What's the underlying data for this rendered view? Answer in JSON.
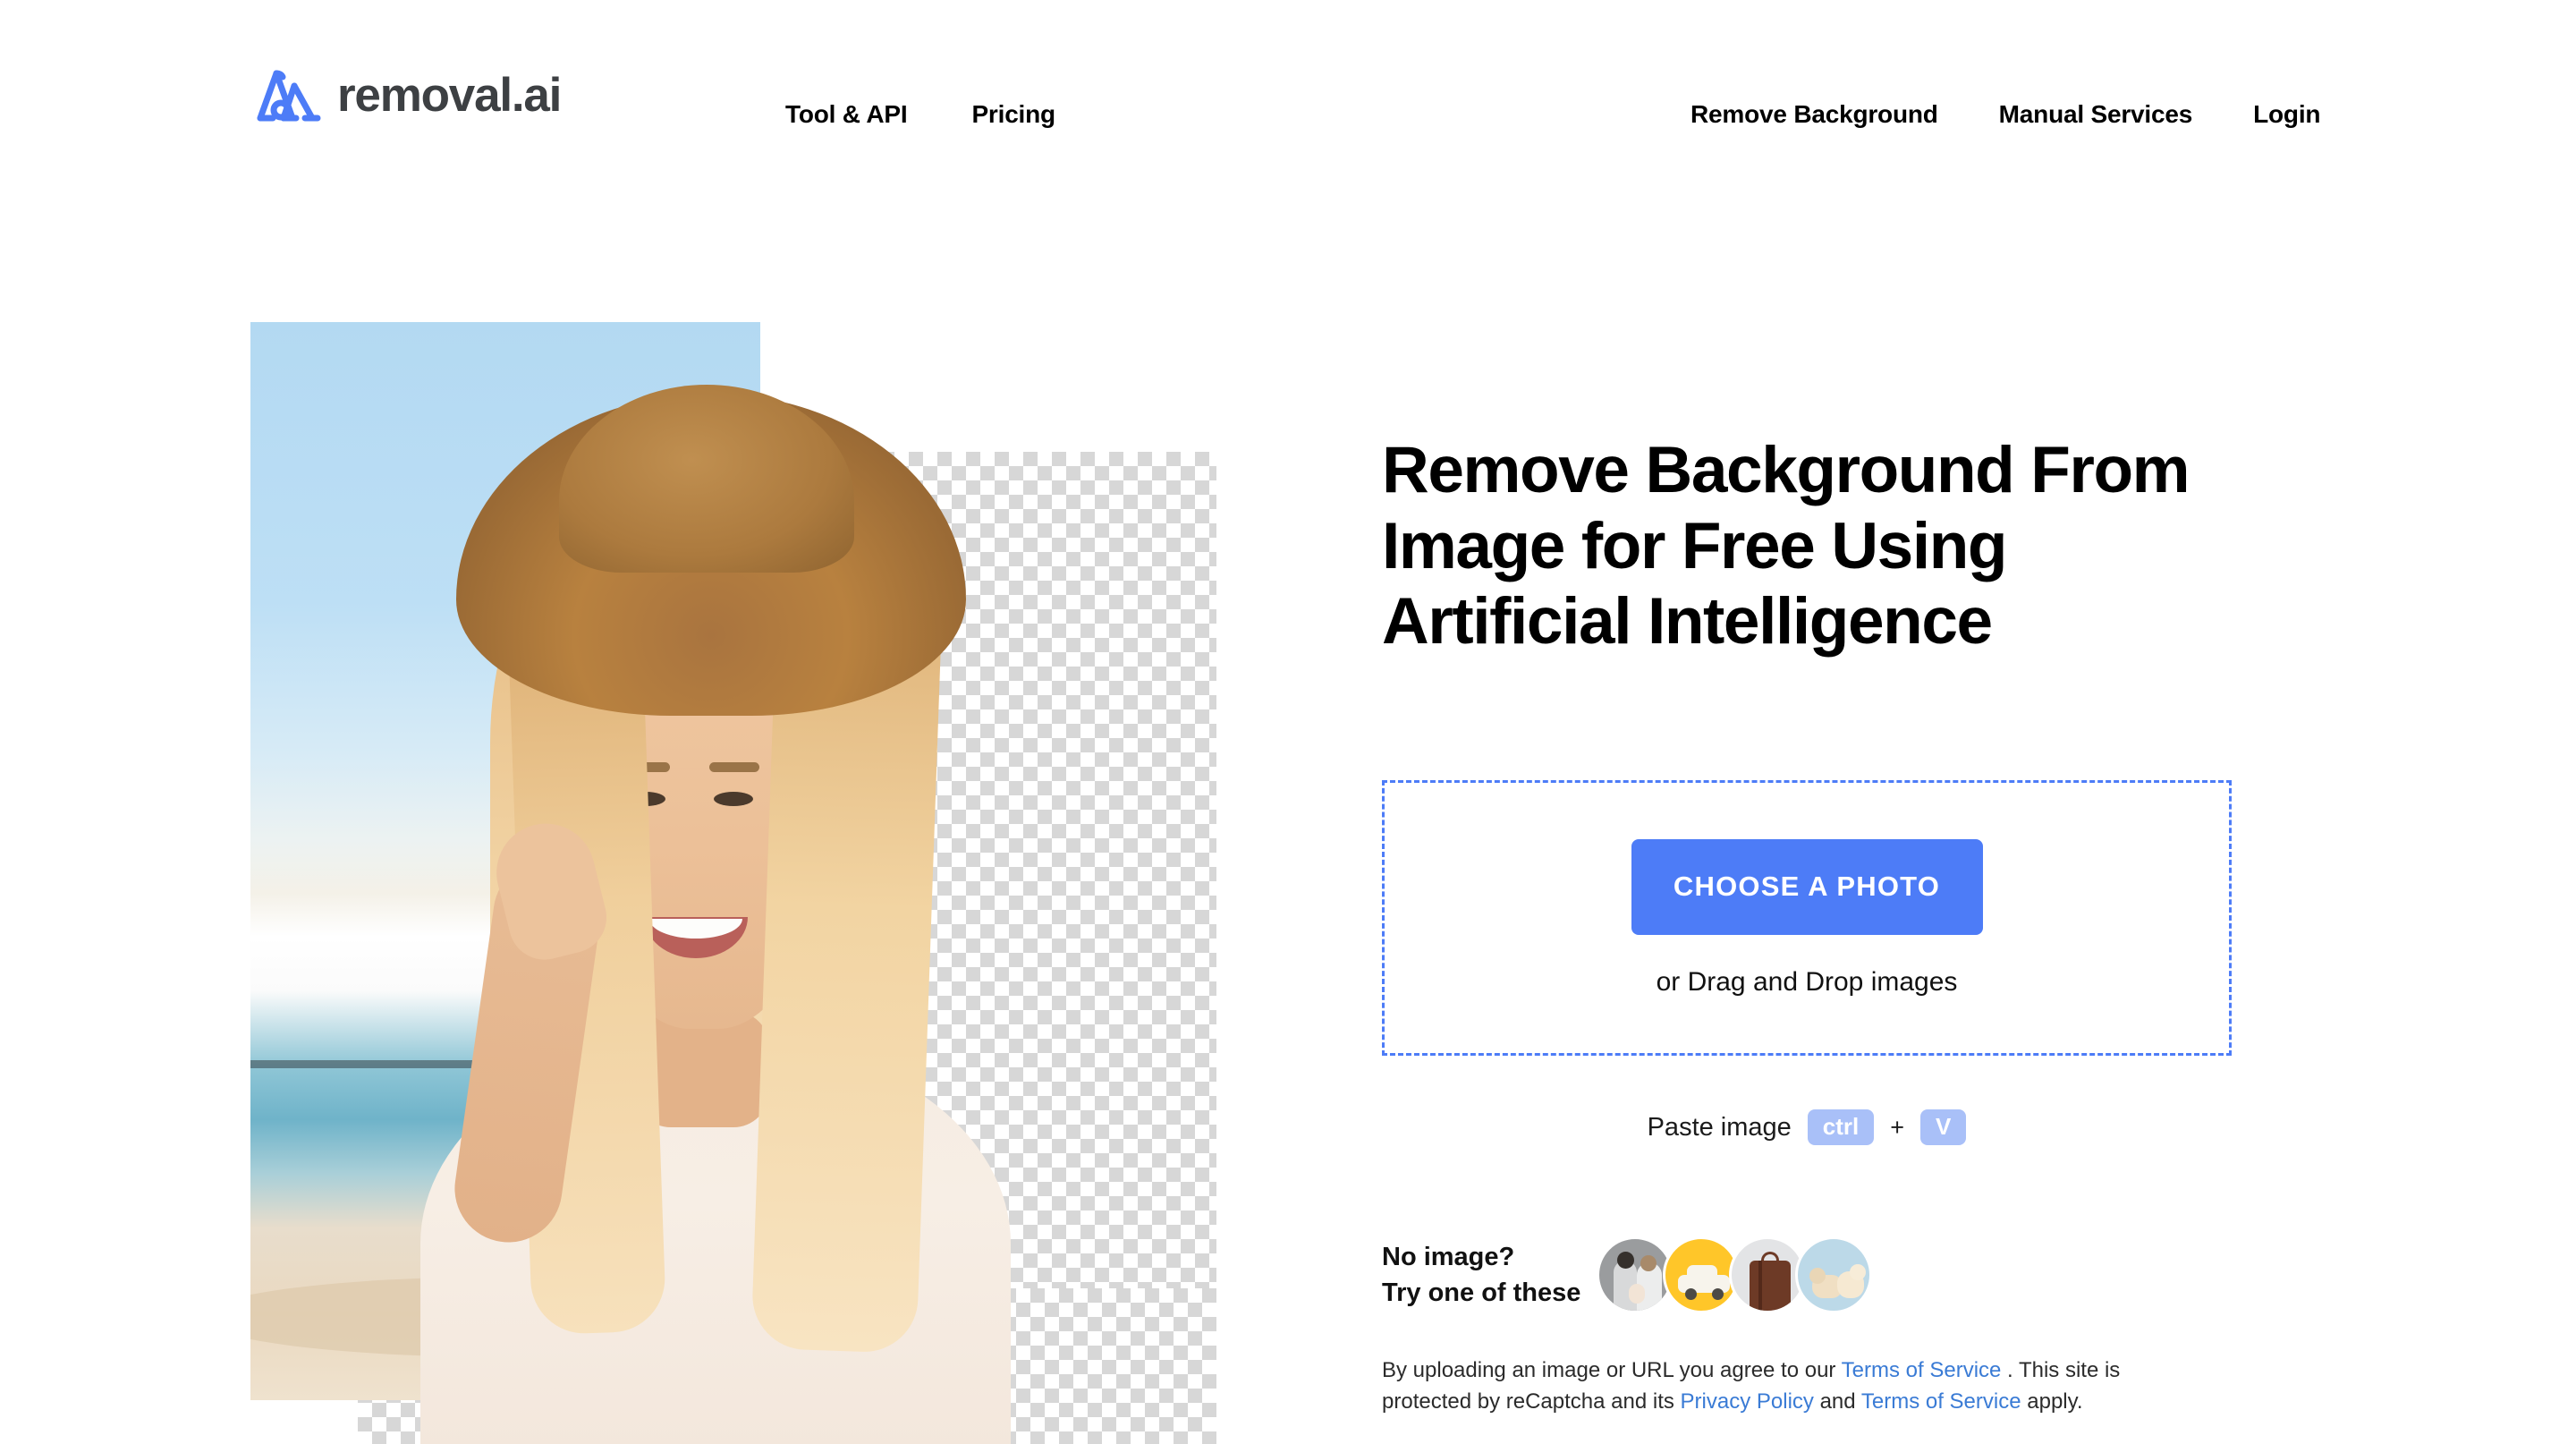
{
  "brand": {
    "name": "removal.ai",
    "logo_color": "#4d7cf7",
    "text_color": "#3d4043"
  },
  "nav": {
    "left_items": [
      {
        "label": "Tool & API"
      },
      {
        "label": "Pricing"
      }
    ],
    "right_items": [
      {
        "label": "Remove Background"
      },
      {
        "label": "Manual Services"
      },
      {
        "label": "Login"
      }
    ]
  },
  "hero": {
    "headline_line1": "Remove Background From",
    "headline_line2": "Image for Free Using",
    "headline_line3": "Artificial Intelligence",
    "image_alt": "Smiling blonde woman in a straw hat at the beach, half of the background removed showing a transparency checkerboard"
  },
  "dropzone": {
    "button_label": "CHOOSE A PHOTO",
    "sub_label": "or Drag and Drop images",
    "border_color": "#4d7cf7",
    "button_color": "#4d7cf7"
  },
  "paste": {
    "label": "Paste image",
    "key1": "ctrl",
    "separator": "+",
    "key2": "V",
    "badge_color": "#a9c0f8"
  },
  "samples": {
    "label_line1": "No image?",
    "label_line2": "Try one of these",
    "thumbnails": [
      {
        "name": "couple-with-baby",
        "background": "#9a9c9e"
      },
      {
        "name": "white-car",
        "background": "#ffc629"
      },
      {
        "name": "brown-suitcase",
        "background": "#e3e4e6"
      },
      {
        "name": "two-puppies",
        "background": "#bcd9e8"
      }
    ]
  },
  "legal": {
    "part1": "By uploading an image or URL you agree to our ",
    "link1": "Terms of Service",
    "part2": " . This site is protected by reCaptcha and its ",
    "link2": "Privacy Policy",
    "part3": " and ",
    "link3": "Terms of Service",
    "part4": " apply.",
    "link_color": "#3a7bd5"
  }
}
